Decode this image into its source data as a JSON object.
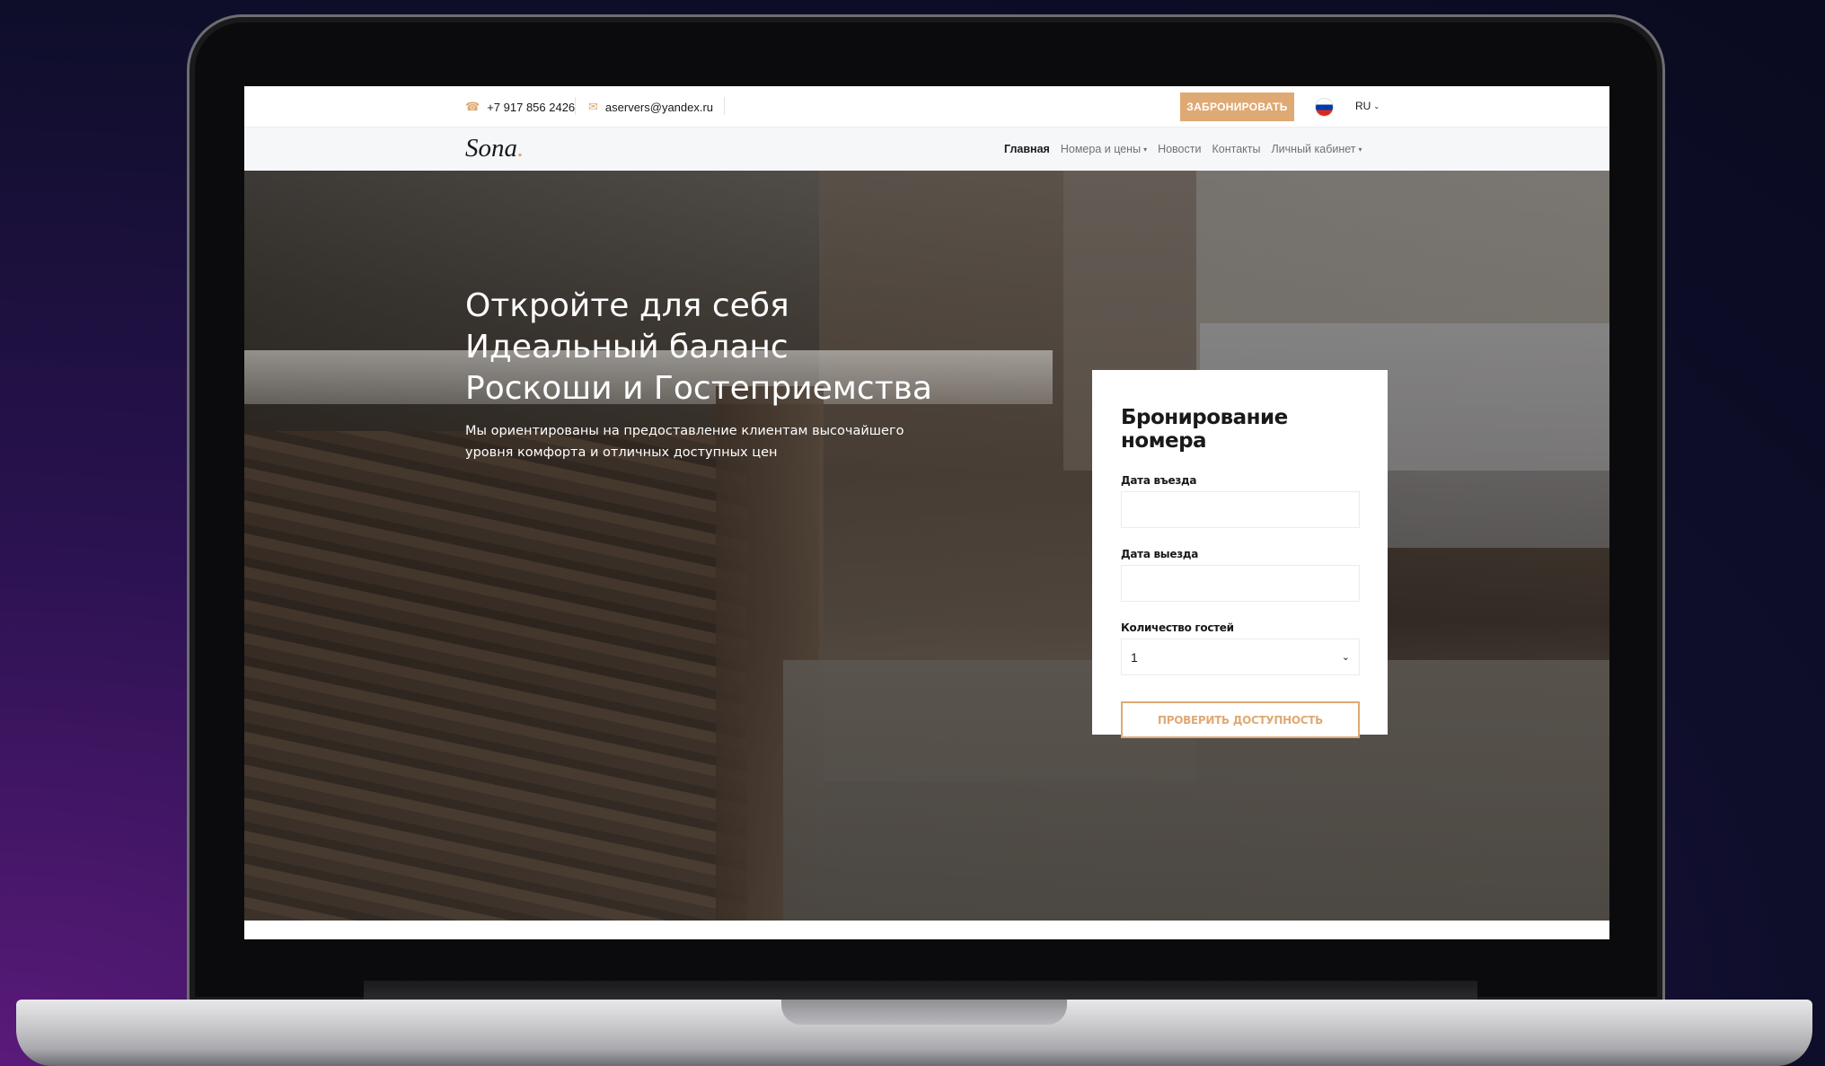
{
  "topbar": {
    "phone": "+7 917 856 2426",
    "email": "aservers@yandex.ru",
    "book_label": "ЗАБРОНИРОВАТЬ",
    "language": "RU"
  },
  "nav": {
    "logo": "Sona",
    "logo_dot": ".",
    "items": [
      {
        "label": "Главная"
      },
      {
        "label": "Номера и цены"
      },
      {
        "label": "Новости"
      },
      {
        "label": "Контакты"
      },
      {
        "label": "Личный кабинет"
      }
    ]
  },
  "hero": {
    "title_line1": "Откройте для себя",
    "title_line2": "Идеальный баланс",
    "title_line3": "Роскоши и Гостеприемства",
    "subtitle_line1": "Мы ориентированы на предоставление клиентам высочайшего",
    "subtitle_line2": "уровня комфорта и отличных доступных цен"
  },
  "booking": {
    "title": "Бронирование номера",
    "checkin_label": "Дата въезда",
    "checkin_value": "",
    "checkout_label": "Дата выезда",
    "checkout_value": "",
    "guests_label": "Количество гостей",
    "guests_value": "1",
    "check_button": "ПРОВЕРИТЬ ДОСТУПНОСТЬ"
  },
  "colors": {
    "accent": "#dfa974",
    "text": "#19191a",
    "muted": "#707079"
  },
  "icons": {
    "phone": "phone-icon",
    "mail": "mail-icon",
    "flag": "russia-flag-icon",
    "chevron": "chevron-down-icon"
  }
}
